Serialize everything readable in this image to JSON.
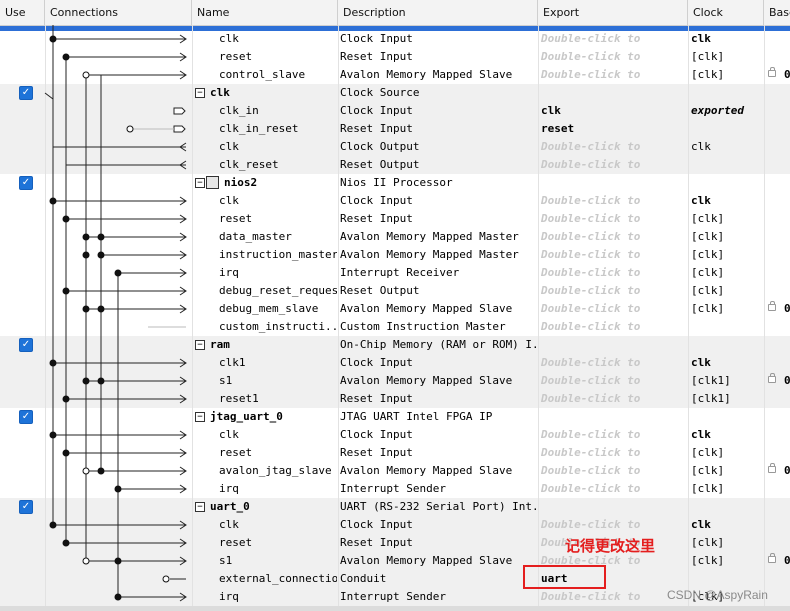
{
  "table": {
    "columns": [
      "Use",
      "Connections",
      "Name",
      "Description",
      "Export",
      "Clock",
      "Base"
    ],
    "rows": [
      {
        "type": "port",
        "name": "clk",
        "desc": "Clock Input",
        "export": "Double-click to",
        "export_style": "placeholder",
        "clock": "clk",
        "clock_style": "bold",
        "base": ""
      },
      {
        "type": "port",
        "name": "reset",
        "desc": "Reset Input",
        "export": "Double-click to",
        "export_style": "placeholder",
        "clock": "[clk]",
        "clock_style": "normal",
        "base": ""
      },
      {
        "type": "port",
        "name": "control_slave",
        "desc": "Avalon Memory Mapped Slave",
        "export": "Double-click to",
        "export_style": "placeholder",
        "clock": "[clk]",
        "clock_style": "normal",
        "base": "0",
        "lock": true
      },
      {
        "type": "component",
        "name": "clk",
        "desc": "Clock Source",
        "export": "",
        "export_style": "normal",
        "clock": "",
        "clock_style": "normal",
        "base": "",
        "checkbox": true
      },
      {
        "type": "port",
        "name": "clk_in",
        "desc": "Clock Input",
        "export": "clk",
        "export_style": "bold",
        "clock": "exported",
        "clock_style": "italic",
        "base": ""
      },
      {
        "type": "port",
        "name": "clk_in_reset",
        "desc": "Reset Input",
        "export": "reset",
        "export_style": "bold",
        "clock": "",
        "clock_style": "normal",
        "base": ""
      },
      {
        "type": "port",
        "name": "clk",
        "desc": "Clock Output",
        "export": "Double-click to",
        "export_style": "placeholder",
        "clock": "clk",
        "clock_style": "normal",
        "base": ""
      },
      {
        "type": "port",
        "name": "clk_reset",
        "desc": "Reset Output",
        "export": "Double-click to",
        "export_style": "placeholder",
        "clock": "",
        "clock_style": "normal",
        "base": ""
      },
      {
        "type": "component",
        "name": "nios2",
        "desc": "Nios II Processor",
        "export": "",
        "export_style": "normal",
        "clock": "",
        "clock_style": "normal",
        "base": "",
        "checkbox": true,
        "icon": "cpu-icon"
      },
      {
        "type": "port",
        "name": "clk",
        "desc": "Clock Input",
        "export": "Double-click to",
        "export_style": "placeholder",
        "clock": "clk",
        "clock_style": "bold",
        "base": ""
      },
      {
        "type": "port",
        "name": "reset",
        "desc": "Reset Input",
        "export": "Double-click to",
        "export_style": "placeholder",
        "clock": "[clk]",
        "clock_style": "normal",
        "base": ""
      },
      {
        "type": "port",
        "name": "data_master",
        "desc": "Avalon Memory Mapped Master",
        "export": "Double-click to",
        "export_style": "placeholder",
        "clock": "[clk]",
        "clock_style": "normal",
        "base": ""
      },
      {
        "type": "port",
        "name": "instruction_master",
        "desc": "Avalon Memory Mapped Master",
        "export": "Double-click to",
        "export_style": "placeholder",
        "clock": "[clk]",
        "clock_style": "normal",
        "base": ""
      },
      {
        "type": "port",
        "name": "irq",
        "desc": "Interrupt Receiver",
        "export": "Double-click to",
        "export_style": "placeholder",
        "clock": "[clk]",
        "clock_style": "normal",
        "base": ""
      },
      {
        "type": "port",
        "name": "debug_reset_request",
        "desc": "Reset Output",
        "export": "Double-click to",
        "export_style": "placeholder",
        "clock": "[clk]",
        "clock_style": "normal",
        "base": ""
      },
      {
        "type": "port",
        "name": "debug_mem_slave",
        "desc": "Avalon Memory Mapped Slave",
        "export": "Double-click to",
        "export_style": "placeholder",
        "clock": "[clk]",
        "clock_style": "normal",
        "base": "0",
        "lock": true
      },
      {
        "type": "port",
        "name": "custom_instructi...",
        "desc": "Custom Instruction Master",
        "export": "Double-click to",
        "export_style": "placeholder",
        "clock": "",
        "clock_style": "normal",
        "base": ""
      },
      {
        "type": "component",
        "name": "ram",
        "desc": "On-Chip Memory (RAM or ROM) I...",
        "export": "",
        "export_style": "normal",
        "clock": "",
        "clock_style": "normal",
        "base": "",
        "checkbox": true
      },
      {
        "type": "port",
        "name": "clk1",
        "desc": "Clock Input",
        "export": "Double-click to",
        "export_style": "placeholder",
        "clock": "clk",
        "clock_style": "bold",
        "base": ""
      },
      {
        "type": "port",
        "name": "s1",
        "desc": "Avalon Memory Mapped Slave",
        "export": "Double-click to",
        "export_style": "placeholder",
        "clock": "[clk1]",
        "clock_style": "normal",
        "base": "0",
        "lock": true
      },
      {
        "type": "port",
        "name": "reset1",
        "desc": "Reset Input",
        "export": "Double-click to",
        "export_style": "placeholder",
        "clock": "[clk1]",
        "clock_style": "normal",
        "base": ""
      },
      {
        "type": "component",
        "name": "jtag_uart_0",
        "desc": "JTAG UART Intel FPGA IP",
        "export": "",
        "export_style": "normal",
        "clock": "",
        "clock_style": "normal",
        "base": "",
        "checkbox": true
      },
      {
        "type": "port",
        "name": "clk",
        "desc": "Clock Input",
        "export": "Double-click to",
        "export_style": "placeholder",
        "clock": "clk",
        "clock_style": "bold",
        "base": ""
      },
      {
        "type": "port",
        "name": "reset",
        "desc": "Reset Input",
        "export": "Double-click to",
        "export_style": "placeholder",
        "clock": "[clk]",
        "clock_style": "normal",
        "base": ""
      },
      {
        "type": "port",
        "name": "avalon_jtag_slave",
        "desc": "Avalon Memory Mapped Slave",
        "export": "Double-click to",
        "export_style": "placeholder",
        "clock": "[clk]",
        "clock_style": "normal",
        "base": "0",
        "lock": true
      },
      {
        "type": "port",
        "name": "irq",
        "desc": "Interrupt Sender",
        "export": "Double-click to",
        "export_style": "placeholder",
        "clock": "[clk]",
        "clock_style": "normal",
        "base": ""
      },
      {
        "type": "component",
        "name": "uart_0",
        "desc": "UART (RS-232 Serial Port) Int...",
        "export": "",
        "export_style": "normal",
        "clock": "",
        "clock_style": "normal",
        "base": "",
        "checkbox": true
      },
      {
        "type": "port",
        "name": "clk",
        "desc": "Clock Input",
        "export": "Double-click to",
        "export_style": "placeholder",
        "clock": "clk",
        "clock_style": "bold",
        "base": ""
      },
      {
        "type": "port",
        "name": "reset",
        "desc": "Reset Input",
        "export": "Double-click to",
        "export_style": "placeholder",
        "clock": "[clk]",
        "clock_style": "normal",
        "base": ""
      },
      {
        "type": "port",
        "name": "s1",
        "desc": "Avalon Memory Mapped Slave",
        "export": "Double-click to",
        "export_style": "placeholder",
        "clock": "[clk]",
        "clock_style": "normal",
        "base": "0",
        "lock": true
      },
      {
        "type": "port",
        "name": "external_connection",
        "desc": "Conduit",
        "export": "uart",
        "export_style": "bold",
        "clock": "",
        "clock_style": "normal",
        "base": ""
      },
      {
        "type": "port",
        "name": "irq",
        "desc": "Interrupt Sender",
        "export": "Double-click to",
        "export_style": "placeholder",
        "clock": "[clk]",
        "clock_style": "normal",
        "base": ""
      }
    ]
  },
  "annotation": {
    "text": "记得更改这里"
  },
  "watermark": {
    "text": "CSDN @AspyRain"
  },
  "colors": {
    "accent": "#1e73d8",
    "annotation": "#e41e1e",
    "shade": "#f0f0f0",
    "placeholder": "#c8c8c8"
  }
}
